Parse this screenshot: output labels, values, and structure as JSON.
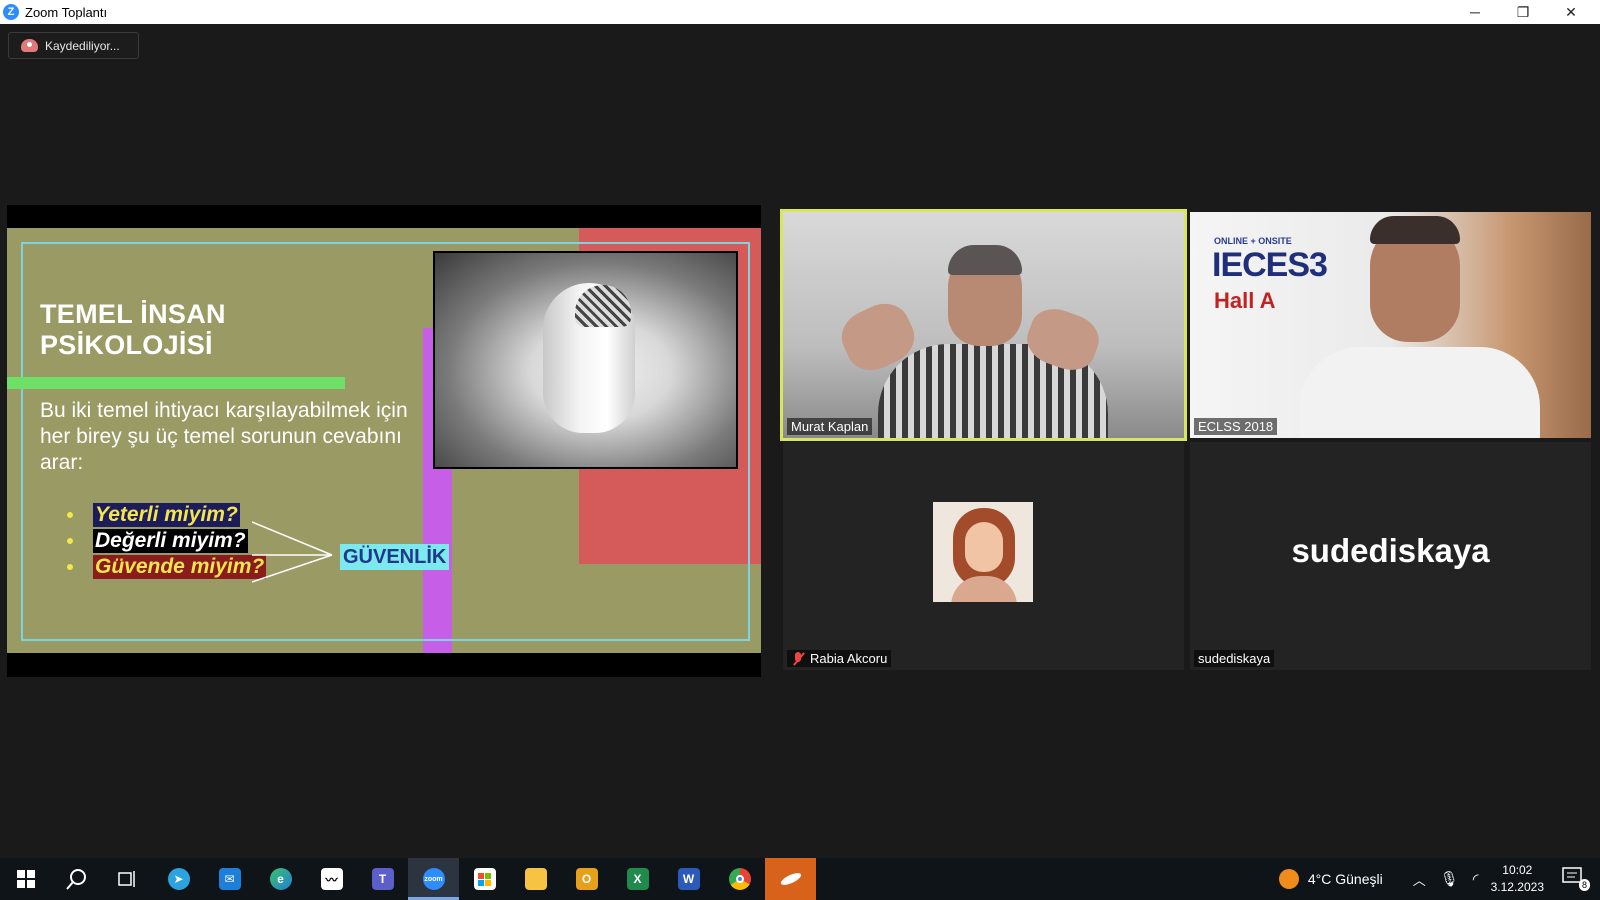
{
  "window": {
    "title": "Zoom Toplantı",
    "min": "─",
    "max": "❐",
    "close": "✕"
  },
  "recording": {
    "label": "Kaydediliyor..."
  },
  "slide": {
    "heading_line1": "TEMEL İNSAN",
    "heading_line2": "PSİKOLOJİSİ",
    "body": "Bu iki temel ihtiyacı karşılayabilmek için her birey şu üç temel sorunun cevabını arar:",
    "questions": [
      "Yeterli miyim?",
      "Değerli miyim?",
      "Güvende miyim?"
    ],
    "answer": "GÜVENLİK"
  },
  "participants": {
    "p1": {
      "name": "Murat Kaplan"
    },
    "p2": {
      "name": "ECLSS 2018",
      "poster_line": "ONLINE + ONSITE",
      "poster_title": "IECES3",
      "poster_hall": "Hall A"
    },
    "p3": {
      "name": "Rabia Akcoru",
      "muted": true
    },
    "p4": {
      "name": "sudediskaya",
      "display_text": "sudediskaya"
    }
  },
  "taskbar": {
    "apps": [
      "start",
      "search",
      "task-view",
      "telegram",
      "mail",
      "edge",
      "stocks",
      "teams",
      "zoom",
      "store",
      "explorer",
      "outlook",
      "excel",
      "word",
      "chrome",
      "app-orange"
    ],
    "weather": "4°C  Güneşli",
    "time": "10:02",
    "date": "3.12.2023",
    "notifications": "8"
  },
  "colors": {
    "active_speaker": "#d6e85a",
    "slide_bg": "#9a9a64",
    "taskbar": "#0f1419"
  }
}
